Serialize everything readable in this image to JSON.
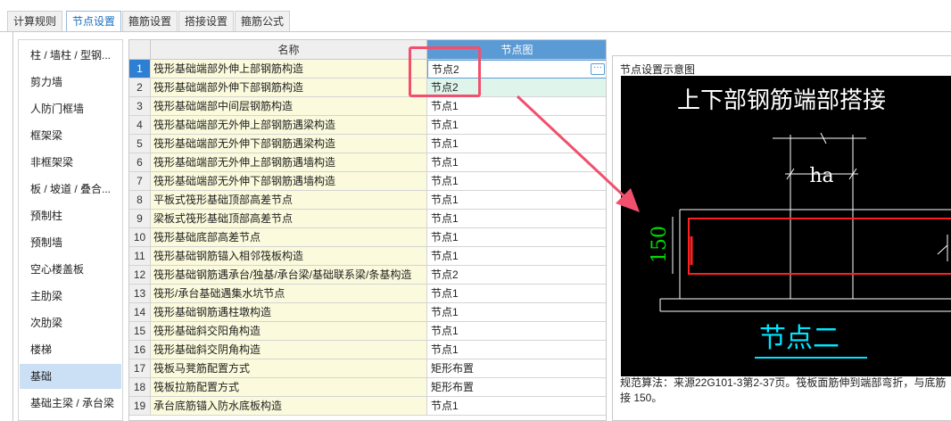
{
  "tabs": [
    {
      "label": "计算规则",
      "active": false
    },
    {
      "label": "节点设置",
      "active": true
    },
    {
      "label": "箍筋设置",
      "active": false
    },
    {
      "label": "搭接设置",
      "active": false
    },
    {
      "label": "箍筋公式",
      "active": false
    }
  ],
  "sidebar": {
    "items": [
      {
        "label": "柱 / 墙柱 / 型钢..."
      },
      {
        "label": "剪力墙"
      },
      {
        "label": "人防门框墙"
      },
      {
        "label": "框架梁"
      },
      {
        "label": "非框架梁"
      },
      {
        "label": "板 / 坡道 / 叠合..."
      },
      {
        "label": "预制柱"
      },
      {
        "label": "预制墙"
      },
      {
        "label": "空心楼盖板"
      },
      {
        "label": "主肋梁"
      },
      {
        "label": "次肋梁"
      },
      {
        "label": "楼梯"
      },
      {
        "label": "基础",
        "selected": true
      },
      {
        "label": "基础主梁 / 承台梁"
      }
    ]
  },
  "grid": {
    "columns": {
      "name": "名称",
      "node": "节点图"
    },
    "ellipsis": "···",
    "rows": [
      {
        "num": "1",
        "name": "筏形基础端部外伸上部钢筋构造",
        "node": "节点2"
      },
      {
        "num": "2",
        "name": "筏形基础端部外伸下部钢筋构造",
        "node": "节点2"
      },
      {
        "num": "3",
        "name": "筏形基础端部中间层钢筋构造",
        "node": "节点1"
      },
      {
        "num": "4",
        "name": "筏形基础端部无外伸上部钢筋遇梁构造",
        "node": "节点1"
      },
      {
        "num": "5",
        "name": "筏形基础端部无外伸下部钢筋遇梁构造",
        "node": "节点1"
      },
      {
        "num": "6",
        "name": "筏形基础端部无外伸上部钢筋遇墙构造",
        "node": "节点1"
      },
      {
        "num": "7",
        "name": "筏形基础端部无外伸下部钢筋遇墙构造",
        "node": "节点1"
      },
      {
        "num": "8",
        "name": "平板式筏形基础顶部高差节点",
        "node": "节点1"
      },
      {
        "num": "9",
        "name": "梁板式筏形基础顶部高差节点",
        "node": "节点1"
      },
      {
        "num": "10",
        "name": "筏形基础底部高差节点",
        "node": "节点1"
      },
      {
        "num": "11",
        "name": "筏形基础钢筋锚入相邻筏板构造",
        "node": "节点1"
      },
      {
        "num": "12",
        "name": "筏形基础钢筋遇承台/独基/承台梁/基础联系梁/条基构造",
        "node": "节点2"
      },
      {
        "num": "13",
        "name": "筏形/承台基础遇集水坑节点",
        "node": "节点1"
      },
      {
        "num": "14",
        "name": "筏形基础钢筋遇柱墩构造",
        "node": "节点1"
      },
      {
        "num": "15",
        "name": "筏形基础斜交阳角构造",
        "node": "节点1"
      },
      {
        "num": "16",
        "name": "筏形基础斜交阴角构造",
        "node": "节点1"
      },
      {
        "num": "17",
        "name": "筏板马凳筋配置方式",
        "node": "矩形布置"
      },
      {
        "num": "18",
        "name": "筏板拉筋配置方式",
        "node": "矩形布置"
      },
      {
        "num": "19",
        "name": "承台底筋锚入防水底板构造",
        "node": "节点1"
      }
    ]
  },
  "preview": {
    "panel_title": "节点设置示意图",
    "diagram_title": "上下部钢筋端部搭接",
    "dim_ha": "ha",
    "dim_150": "150",
    "node_label": "节点二",
    "description_line1": "规范算法：来源22G101-3第2-37页。筏板面筋伸到端部弯折，与底筋",
    "description_line2": "接 150。"
  },
  "colors": {
    "accent": "#5b9bd5",
    "selected_row": "#2d7fd4",
    "annotation": "#f0506e",
    "name_cell_bg": "#fbfadc",
    "highlight_cell": "#dff5ec",
    "diagram_red": "#ff2020",
    "diagram_green": "#00dd00",
    "diagram_cyan": "#00e5ff"
  }
}
